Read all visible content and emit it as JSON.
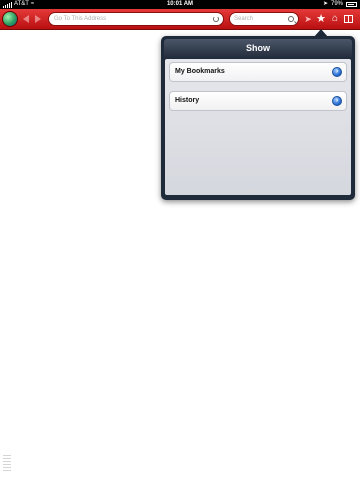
{
  "status_bar": {
    "carrier": "AT&T",
    "time": "10:01 AM",
    "battery_percent": "79%"
  },
  "toolbar": {
    "address_placeholder": "Go To This Address",
    "search_placeholder": "Search",
    "accent_color": "#d01a1b"
  },
  "popover": {
    "title": "Show",
    "items": [
      {
        "label": "My Bookmarks"
      },
      {
        "label": "History"
      }
    ]
  }
}
